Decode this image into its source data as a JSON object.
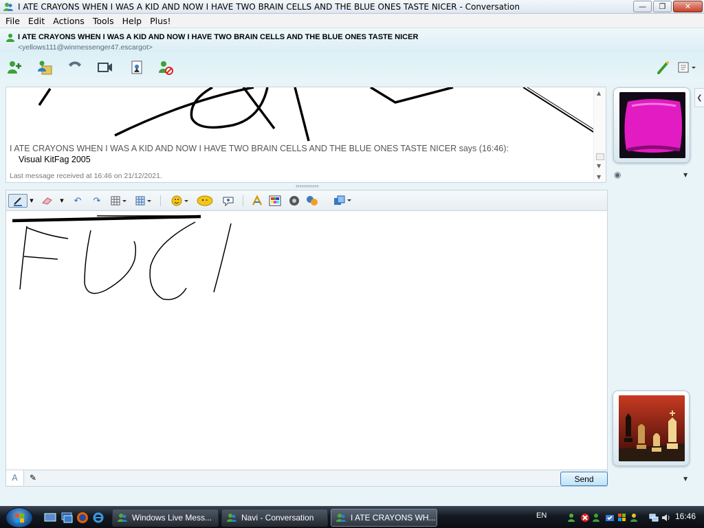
{
  "window": {
    "title": "I ATE CRAYONS WHEN I WAS A KID AND NOW I HAVE TWO BRAIN CELLS AND THE BLUE ONES TASTE NICER - Conversation",
    "minimize": "—",
    "maximize": "❐",
    "close": "✕"
  },
  "menu": [
    "File",
    "Edit",
    "Actions",
    "Tools",
    "Help",
    "Plus!"
  ],
  "contact": {
    "name": "I ATE CRAYONS WHEN I WAS A KID AND NOW I HAVE TWO BRAIN CELLS AND THE BLUE ONES TASTE NICER",
    "email": "<yellows111@winmessenger47.escargot>",
    "status_color": "#3aa23a"
  },
  "toolbar_icons": [
    "invite-contact-icon",
    "share-files-icon",
    "call-icon",
    "video-call-icon",
    "activities-icon",
    "block-contact-icon",
    "wink-color-icon",
    "display-options-icon"
  ],
  "history": {
    "says_line": "I ATE CRAYONS WHEN I WAS A KID AND NOW I HAVE TWO BRAIN CELLS AND THE BLUE ONES TASTE NICER says (16:46):",
    "message": "Visual KitFag 2005",
    "last_received": "Last message received at 16:46 on 21/12/2021."
  },
  "compose_toolbar_icons": [
    "pen-icon",
    "eraser-icon",
    "undo-icon",
    "redo-icon",
    "grid-icon",
    "background-icon",
    "emoticon-icon",
    "wink-icon",
    "nudge-icon",
    "font-icon",
    "color-picker-icon",
    "voice-clip-icon",
    "games-icon",
    "layout-icon"
  ],
  "bottom": {
    "text_mode": "A",
    "ink_mode": "✎",
    "send_label": "Send"
  },
  "colors": {
    "accent": "#dcf0f6",
    "avatar_top_bg": "#e21cc2",
    "taskbar": "#141a22"
  },
  "taskbar": {
    "items": [
      {
        "label": "Windows Live Mess..."
      },
      {
        "label": "Navi - Conversation"
      },
      {
        "label": "I ATE CRAYONS WH..."
      }
    ],
    "language": "EN",
    "clock": "16:46"
  }
}
